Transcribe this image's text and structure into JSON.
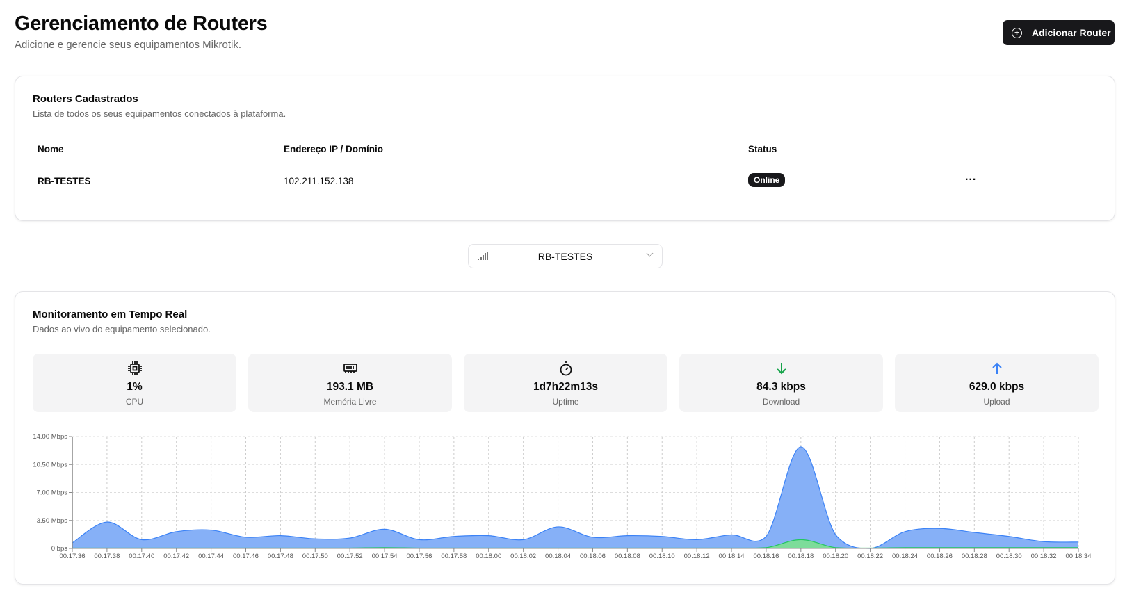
{
  "header": {
    "title": "Gerenciamento de Routers",
    "subtitle": "Adicione e gerencie seus equipamentos Mikrotik.",
    "add_button": "Adicionar Router",
    "add_icon": "plus-circle-icon"
  },
  "routers_card": {
    "title": "Routers Cadastrados",
    "subtitle": "Lista de todos os seus equipamentos conectados à plataforma.",
    "columns": [
      "Nome",
      "Endereço IP / Domínio",
      "Status"
    ],
    "rows": [
      {
        "name": "RB-TESTES",
        "ip": "102.211.152.138",
        "status": "Online",
        "actions": "..."
      }
    ]
  },
  "selector": {
    "value": "RB-TESTES",
    "icon": "signal-icon"
  },
  "monitor_card": {
    "title": "Monitoramento em Tempo Real",
    "subtitle": "Dados ao vivo do equipamento selecionado.",
    "stats": [
      {
        "icon": "cpu-icon",
        "value": "1%",
        "label": "CPU"
      },
      {
        "icon": "memory-icon",
        "value": "193.1 MB",
        "label": "Memória Livre"
      },
      {
        "icon": "timer-icon",
        "value": "1d7h22m13s",
        "label": "Uptime"
      },
      {
        "icon": "arrow-down-icon",
        "value": "84.3 kbps",
        "label": "Download",
        "color": "#16a34a"
      },
      {
        "icon": "arrow-up-icon",
        "value": "629.0 kbps",
        "label": "Upload",
        "color": "#3b82f6"
      }
    ]
  },
  "chart_data": {
    "type": "area",
    "grid": true,
    "ylim": [
      0,
      14
    ],
    "yticks": [
      "0 bps",
      "3.50 Mbps",
      "7.00 Mbps",
      "10.50 Mbps",
      "14.00 Mbps"
    ],
    "ytick_values": [
      0,
      3.5,
      7,
      10.5,
      14
    ],
    "x": [
      "00:17:36",
      "00:17:38",
      "00:17:40",
      "00:17:42",
      "00:17:44",
      "00:17:46",
      "00:17:48",
      "00:17:50",
      "00:17:52",
      "00:17:54",
      "00:17:56",
      "00:17:58",
      "00:18:00",
      "00:18:02",
      "00:18:04",
      "00:18:06",
      "00:18:08",
      "00:18:10",
      "00:18:12",
      "00:18:14",
      "00:18:16",
      "00:18:18",
      "00:18:20",
      "00:18:22",
      "00:18:24",
      "00:18:26",
      "00:18:28",
      "00:18:30",
      "00:18:32",
      "00:18:34"
    ],
    "series": [
      {
        "color": "#3b82f6",
        "fill": "#86b0f7",
        "values": [
          0.7,
          3.3,
          1.1,
          2.1,
          2.3,
          1.4,
          1.6,
          1.2,
          1.3,
          2.4,
          1.1,
          1.5,
          1.6,
          1.1,
          2.7,
          1.4,
          1.6,
          1.5,
          1.1,
          1.7,
          1.5,
          12.7,
          1.7,
          0.0,
          2.1,
          2.5,
          2.0,
          1.5,
          0.85,
          0.8
        ]
      },
      {
        "color": "#22c55e",
        "fill": "#7ddc9a",
        "values": [
          0.05,
          0.05,
          0.05,
          0.05,
          0.05,
          0.05,
          0.05,
          0.05,
          0.05,
          0.1,
          0.05,
          0.05,
          0.05,
          0.05,
          0.05,
          0.05,
          0.05,
          0.05,
          0.05,
          0.05,
          0.1,
          1.1,
          0.1,
          0.05,
          0.1,
          0.1,
          0.1,
          0.1,
          0.1,
          0.1
        ]
      }
    ]
  }
}
